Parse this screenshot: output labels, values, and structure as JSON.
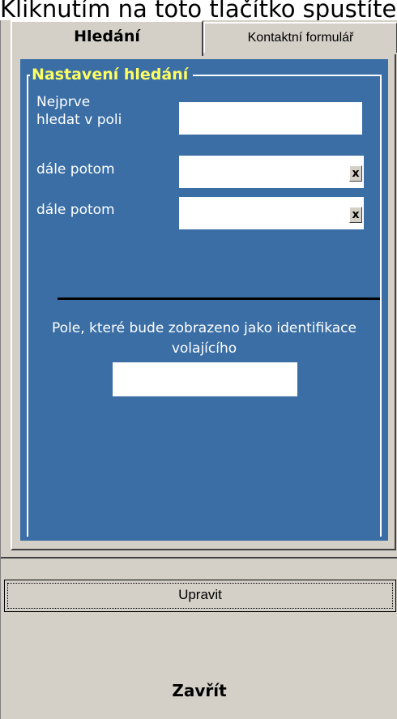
{
  "caption": "Kliknutím na toto tlačítko spustíte",
  "tabs": [
    {
      "label": "Hledání",
      "active": true
    },
    {
      "label": "Kontaktní formulář",
      "active": false
    }
  ],
  "search_settings": {
    "legend": "Nastavení hledání",
    "first_field_label": "Nejprve\nhledat v poli",
    "first_field_value": "",
    "then_label_1": "dále potom",
    "then_value_1": "",
    "then_label_2": "dále potom",
    "then_value_2": "",
    "clear_glyph": "x",
    "caller_id_label": "Pole, které bude zobrazeno jako identifikace volajícího",
    "caller_id_value": ""
  },
  "buttons": {
    "edit_label": "Upravit",
    "close_label": "Zavřít"
  },
  "colors": {
    "panel_blue": "#3a6ea5",
    "legend_yellow": "#ffff60",
    "dialog_gray": "#d4d0c8"
  }
}
